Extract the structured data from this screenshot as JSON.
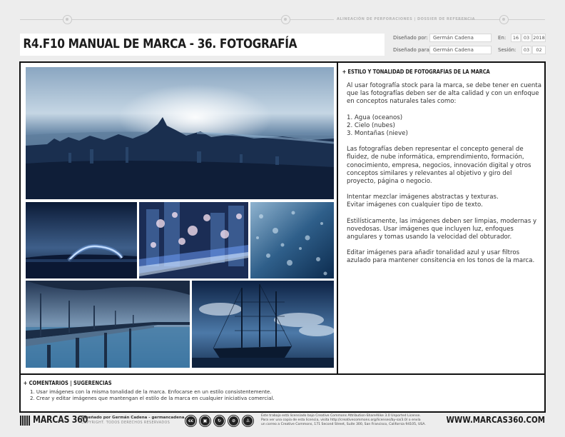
{
  "guide": {
    "caption": "ALINEACIÓN DE PERFORACIONES | DOSSIER DE REFERENCIA"
  },
  "header": {
    "title": "R4.F10 MANUAL DE MARCA - 36. FOTOGRAFÍA",
    "designed_by_label": "Diseñado por:",
    "designed_by_value": "Germán Cadena",
    "designed_for_label": "Diseñado para:",
    "designed_for_value": "Germán Cadena",
    "date_label": "En:",
    "date_day": "16",
    "date_month": "03",
    "date_year": "2018",
    "session_label": "Sesión:",
    "session_a": "03",
    "session_b": "02"
  },
  "photos": [
    {
      "name": "city-skyline-aerial"
    },
    {
      "name": "lake-light-trail"
    },
    {
      "name": "city-bokeh-lights"
    },
    {
      "name": "water-droplets"
    },
    {
      "name": "bridge-over-sea"
    },
    {
      "name": "tall-ship-harbor"
    }
  ],
  "side_panel": {
    "heading": "+ ESTILO Y TONALIDAD DE FOTOGRAFÍAS DE LA MARCA",
    "intro": "Al usar fotografía stock para la marca, se debe tener en cuenta que las fotografías deben ser de alta calidad y con un enfoque en conceptos naturales tales como:",
    "list": [
      "1. Agua (oceanos)",
      "2. Cielo (nubes)",
      "3. Montañas (nieve)"
    ],
    "p2": "Las fotografías deben representar el concepto general de fluidez, de nube informática, emprendimiento, formación, conocimiento, empresa, negocios, innovación digital y otros conceptos similares y relevantes al objetivo y giro del proyecto, página o negocio.",
    "p3a": "Intentar mezclar imágenes abstractas y texturas.",
    "p3b": "Evitar imágenes con cualquier tipo de texto.",
    "p4": "Estilísticamente, las imágenes deben ser limpias, modernas y novedosas. Usar imágenes que incluyen luz, enfoques angulares y tomas usando la velocidad del obturador.",
    "p5": "Editar imágenes para añadir tonalidad azul y usar filtros azulado para mantener consitencia en los tonos de la marca."
  },
  "comments": {
    "heading": "+ COMENTARIOS | SUGERENCIAS",
    "items": [
      "1. Usar imágenes con la misma tonalidad de la marca. Enfocarse en un estilo consistentemente.",
      "2. Crear y editar imágenes que mantengan el estilo de la marca en cualquier iniciativa comercial."
    ]
  },
  "footer": {
    "logo": "MARCAS 360",
    "designed_line": "Diseñado por Germán Cadena - germancadena.com",
    "copyright": "COPYRIGHT. TODOS DERECHOS RESERVADOS",
    "cc_icons": [
      "cc",
      "by",
      "sa",
      "nc",
      "person"
    ],
    "license_1": "Este trabajo está licensiado bajo Creative Commons Attribution-ShareAlike 3.0 Unported License.",
    "license_2": "Para ver una copia de esta licencia, visita http://creativecommons.org/licenses/by-sa/3.0/ o envía",
    "license_3": "un correo a Creative Commons, 171 Second Street, Suite 300, San Francisco, California 94105, USA.",
    "website": "WWW.MARCAS360.COM"
  },
  "colors": {
    "brand_blue": "#1f3d6e",
    "frame": "#111111",
    "page_bg": "#ededed"
  }
}
